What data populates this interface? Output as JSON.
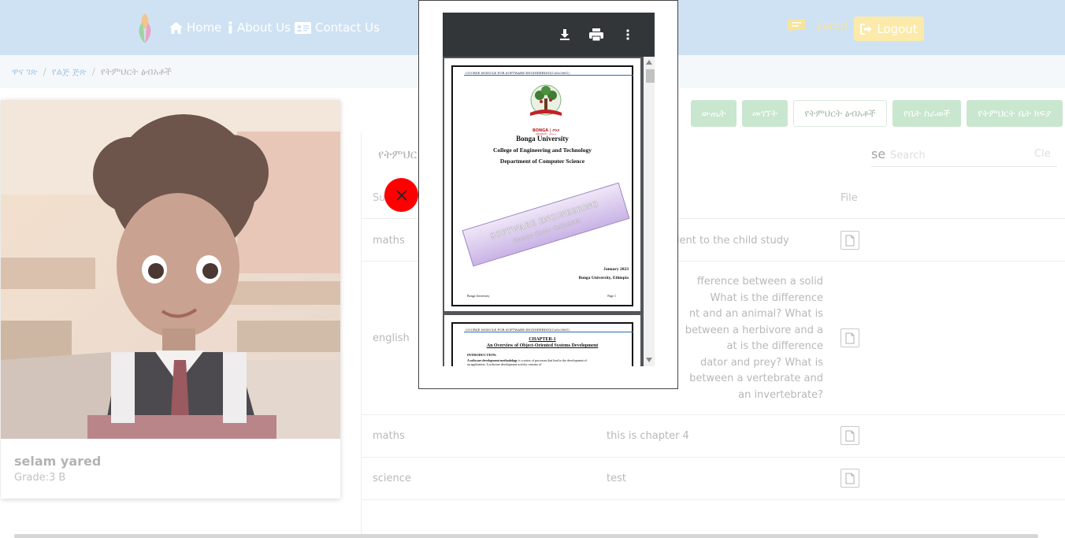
{
  "navbar": {
    "links": [
      {
        "label": "Home",
        "icon": "home-icon"
      },
      {
        "label": "About Us",
        "icon": "info-icon"
      },
      {
        "label": "Contact Us",
        "icon": "address-card-icon"
      }
    ],
    "user_name": "yared",
    "logout_label": "Logout"
  },
  "breadcrumb": {
    "items": [
      "ዋና ገጽ",
      "የልጅ ጅጽ",
      "የትምህርት ፅብአቶች"
    ]
  },
  "profile": {
    "name": "selam yared",
    "grade": "Grade:3 B"
  },
  "tabs": [
    "ውጤት",
    "መገኘት",
    "የትምህርት ፅብአቶች",
    "የቤት ስራወች",
    "የትምህርት ቤት ክፍያ"
  ],
  "panel": {
    "title": "የትምህር",
    "search_prefix": "se",
    "search_placeholder": "Search",
    "search_clear": "Cle"
  },
  "table": {
    "headers": {
      "subject": "Su",
      "file": "File"
    },
    "rows": [
      {
        "subject": "maths",
        "description": "udent to the child study"
      },
      {
        "subject": "english",
        "description": "fference between a solid\nWhat is the difference\nnt and an animal? What is\nbetween a herbivore and a\nat is the difference\ndator and prey? What is\nbetween a vertebrate and\nan invertebrate?"
      },
      {
        "subject": "maths",
        "description": "this is chapter 4"
      },
      {
        "subject": "science",
        "description": "test"
      }
    ]
  },
  "pdf": {
    "page1": {
      "header": "COURSE MODULE FOR SOFTWARE ENGINEERING(CoSc3061)",
      "logo_text": "BONGA | ቦንጋ",
      "logo_sub": "UNIVERSITY · ዩኒቨርሲቲ",
      "university": "Bonga University",
      "college": "College of Engineering and Technology",
      "department": "Department of Computer Science",
      "banner_title": "SOFTWARE ENGINEERING",
      "banner_code": "Course Code: CoSc3061",
      "date": "January 2023",
      "location": "Bonga University, Ethiopia",
      "footer_left": "Bonga University",
      "footer_right": "Page 1"
    },
    "page2": {
      "header": "COURSE MODULE FOR SOFTWARE ENGINEERING(CoSc3061)",
      "chapter": "CHAPTER-1",
      "chapter_title": "An Overview of Object-Oriented Systems Development",
      "intro": "INTRODUCTION:",
      "intro_bold": "A software development methodology",
      "intro_text": "is a series of processes that lead to the development of",
      "intro_text2": "an application. A software development activity consists of"
    }
  },
  "colors": {
    "navbar": "#cfe2f3",
    "tab_green": "#c9e6cf",
    "close": "#ff0000",
    "pdf_toolbar": "#323639"
  }
}
